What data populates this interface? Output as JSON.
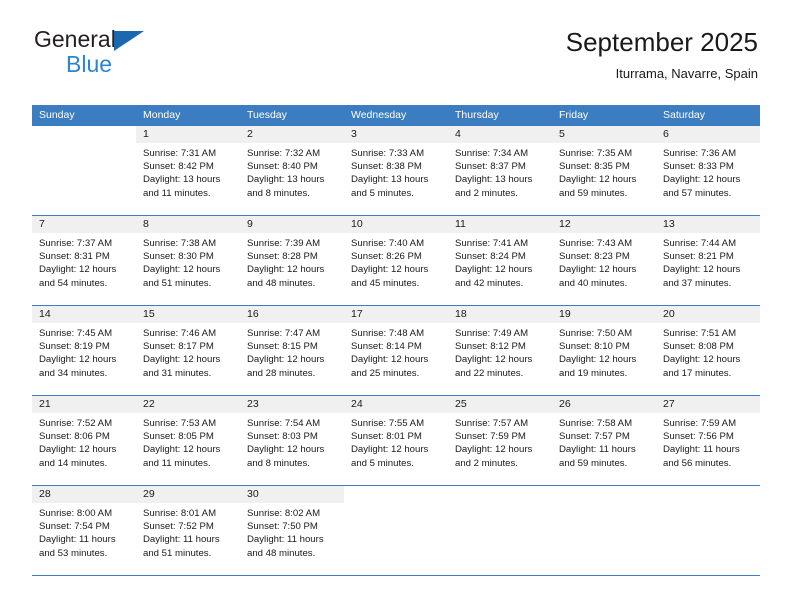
{
  "brand": {
    "word_one": "General",
    "word_two": "Blue",
    "triangle_icon": "triangle-icon"
  },
  "header": {
    "title": "September 2025",
    "subtitle": "Iturrama, Navarre, Spain"
  },
  "colors": {
    "header_blue": "#3b7dc0",
    "day_number_band": "#f0f0f0",
    "brand_blue": "#2b84d4",
    "brand_dark": "#231f20",
    "text": "#1a1a1a"
  },
  "calendar": {
    "weekdays": [
      "Sunday",
      "Monday",
      "Tuesday",
      "Wednesday",
      "Thursday",
      "Friday",
      "Saturday"
    ],
    "labels": {
      "sunrise": "Sunrise:",
      "sunset": "Sunset:",
      "daylight": "Daylight:"
    },
    "weeks": [
      [
        {
          "day": "",
          "blank": true
        },
        {
          "day": "1",
          "sunrise": "Sunrise: 7:31 AM",
          "sunset": "Sunset: 8:42 PM",
          "daylight": "Daylight: 13 hours and 11 minutes."
        },
        {
          "day": "2",
          "sunrise": "Sunrise: 7:32 AM",
          "sunset": "Sunset: 8:40 PM",
          "daylight": "Daylight: 13 hours and 8 minutes."
        },
        {
          "day": "3",
          "sunrise": "Sunrise: 7:33 AM",
          "sunset": "Sunset: 8:38 PM",
          "daylight": "Daylight: 13 hours and 5 minutes."
        },
        {
          "day": "4",
          "sunrise": "Sunrise: 7:34 AM",
          "sunset": "Sunset: 8:37 PM",
          "daylight": "Daylight: 13 hours and 2 minutes."
        },
        {
          "day": "5",
          "sunrise": "Sunrise: 7:35 AM",
          "sunset": "Sunset: 8:35 PM",
          "daylight": "Daylight: 12 hours and 59 minutes."
        },
        {
          "day": "6",
          "sunrise": "Sunrise: 7:36 AM",
          "sunset": "Sunset: 8:33 PM",
          "daylight": "Daylight: 12 hours and 57 minutes."
        }
      ],
      [
        {
          "day": "7",
          "sunrise": "Sunrise: 7:37 AM",
          "sunset": "Sunset: 8:31 PM",
          "daylight": "Daylight: 12 hours and 54 minutes."
        },
        {
          "day": "8",
          "sunrise": "Sunrise: 7:38 AM",
          "sunset": "Sunset: 8:30 PM",
          "daylight": "Daylight: 12 hours and 51 minutes."
        },
        {
          "day": "9",
          "sunrise": "Sunrise: 7:39 AM",
          "sunset": "Sunset: 8:28 PM",
          "daylight": "Daylight: 12 hours and 48 minutes."
        },
        {
          "day": "10",
          "sunrise": "Sunrise: 7:40 AM",
          "sunset": "Sunset: 8:26 PM",
          "daylight": "Daylight: 12 hours and 45 minutes."
        },
        {
          "day": "11",
          "sunrise": "Sunrise: 7:41 AM",
          "sunset": "Sunset: 8:24 PM",
          "daylight": "Daylight: 12 hours and 42 minutes."
        },
        {
          "day": "12",
          "sunrise": "Sunrise: 7:43 AM",
          "sunset": "Sunset: 8:23 PM",
          "daylight": "Daylight: 12 hours and 40 minutes."
        },
        {
          "day": "13",
          "sunrise": "Sunrise: 7:44 AM",
          "sunset": "Sunset: 8:21 PM",
          "daylight": "Daylight: 12 hours and 37 minutes."
        }
      ],
      [
        {
          "day": "14",
          "sunrise": "Sunrise: 7:45 AM",
          "sunset": "Sunset: 8:19 PM",
          "daylight": "Daylight: 12 hours and 34 minutes."
        },
        {
          "day": "15",
          "sunrise": "Sunrise: 7:46 AM",
          "sunset": "Sunset: 8:17 PM",
          "daylight": "Daylight: 12 hours and 31 minutes."
        },
        {
          "day": "16",
          "sunrise": "Sunrise: 7:47 AM",
          "sunset": "Sunset: 8:15 PM",
          "daylight": "Daylight: 12 hours and 28 minutes."
        },
        {
          "day": "17",
          "sunrise": "Sunrise: 7:48 AM",
          "sunset": "Sunset: 8:14 PM",
          "daylight": "Daylight: 12 hours and 25 minutes."
        },
        {
          "day": "18",
          "sunrise": "Sunrise: 7:49 AM",
          "sunset": "Sunset: 8:12 PM",
          "daylight": "Daylight: 12 hours and 22 minutes."
        },
        {
          "day": "19",
          "sunrise": "Sunrise: 7:50 AM",
          "sunset": "Sunset: 8:10 PM",
          "daylight": "Daylight: 12 hours and 19 minutes."
        },
        {
          "day": "20",
          "sunrise": "Sunrise: 7:51 AM",
          "sunset": "Sunset: 8:08 PM",
          "daylight": "Daylight: 12 hours and 17 minutes."
        }
      ],
      [
        {
          "day": "21",
          "sunrise": "Sunrise: 7:52 AM",
          "sunset": "Sunset: 8:06 PM",
          "daylight": "Daylight: 12 hours and 14 minutes."
        },
        {
          "day": "22",
          "sunrise": "Sunrise: 7:53 AM",
          "sunset": "Sunset: 8:05 PM",
          "daylight": "Daylight: 12 hours and 11 minutes."
        },
        {
          "day": "23",
          "sunrise": "Sunrise: 7:54 AM",
          "sunset": "Sunset: 8:03 PM",
          "daylight": "Daylight: 12 hours and 8 minutes."
        },
        {
          "day": "24",
          "sunrise": "Sunrise: 7:55 AM",
          "sunset": "Sunset: 8:01 PM",
          "daylight": "Daylight: 12 hours and 5 minutes."
        },
        {
          "day": "25",
          "sunrise": "Sunrise: 7:57 AM",
          "sunset": "Sunset: 7:59 PM",
          "daylight": "Daylight: 12 hours and 2 minutes."
        },
        {
          "day": "26",
          "sunrise": "Sunrise: 7:58 AM",
          "sunset": "Sunset: 7:57 PM",
          "daylight": "Daylight: 11 hours and 59 minutes."
        },
        {
          "day": "27",
          "sunrise": "Sunrise: 7:59 AM",
          "sunset": "Sunset: 7:56 PM",
          "daylight": "Daylight: 11 hours and 56 minutes."
        }
      ],
      [
        {
          "day": "28",
          "sunrise": "Sunrise: 8:00 AM",
          "sunset": "Sunset: 7:54 PM",
          "daylight": "Daylight: 11 hours and 53 minutes."
        },
        {
          "day": "29",
          "sunrise": "Sunrise: 8:01 AM",
          "sunset": "Sunset: 7:52 PM",
          "daylight": "Daylight: 11 hours and 51 minutes."
        },
        {
          "day": "30",
          "sunrise": "Sunrise: 8:02 AM",
          "sunset": "Sunset: 7:50 PM",
          "daylight": "Daylight: 11 hours and 48 minutes."
        },
        {
          "day": "",
          "blank": true
        },
        {
          "day": "",
          "blank": true
        },
        {
          "day": "",
          "blank": true
        },
        {
          "day": "",
          "blank": true
        }
      ]
    ]
  }
}
